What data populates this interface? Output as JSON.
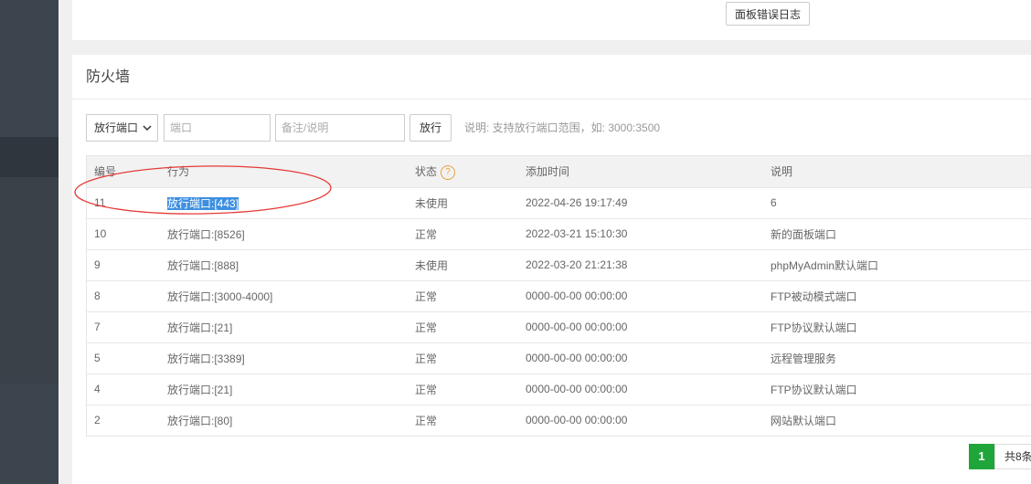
{
  "top": {
    "error_log_button": "面板错误日志"
  },
  "firewall": {
    "title": "防火墙",
    "form": {
      "type_select": "放行端口",
      "port_placeholder": "端口",
      "note_placeholder": "备注/说明",
      "submit": "放行",
      "hint": "说明: 支持放行端口范围，如: 3000:3500"
    },
    "table": {
      "headers": {
        "id": "编号",
        "action": "行为",
        "status": "状态",
        "time": "添加时间",
        "note": "说明"
      },
      "help_icon": "?",
      "rows": [
        {
          "id": "11",
          "action": "放行端口:[443]",
          "status": "未使用",
          "time": "2022-04-26 19:17:49",
          "note": "6"
        },
        {
          "id": "10",
          "action": "放行端口:[8526]",
          "status": "正常",
          "time": "2022-03-21 15:10:30",
          "note": "新的面板端口"
        },
        {
          "id": "9",
          "action": "放行端口:[888]",
          "status": "未使用",
          "time": "2022-03-20 21:21:38",
          "note": "phpMyAdmin默认端口"
        },
        {
          "id": "8",
          "action": "放行端口:[3000-4000]",
          "status": "正常",
          "time": "0000-00-00 00:00:00",
          "note": "FTP被动模式端口"
        },
        {
          "id": "7",
          "action": "放行端口:[21]",
          "status": "正常",
          "time": "0000-00-00 00:00:00",
          "note": "FTP协议默认端口"
        },
        {
          "id": "5",
          "action": "放行端口:[3389]",
          "status": "正常",
          "time": "0000-00-00 00:00:00",
          "note": "远程管理服务"
        },
        {
          "id": "4",
          "action": "放行端口:[21]",
          "status": "正常",
          "time": "0000-00-00 00:00:00",
          "note": "FTP协议默认端口"
        },
        {
          "id": "2",
          "action": "放行端口:[80]",
          "status": "正常",
          "time": "0000-00-00 00:00:00",
          "note": "网站默认端口"
        }
      ]
    },
    "pagination": {
      "current": "1",
      "total": "共8条"
    }
  },
  "colors": {
    "accent_green": "#20a53a",
    "selection_blue": "#3d8fe0",
    "annotation_red": "#e53935",
    "sidebar": "#3c444d"
  }
}
